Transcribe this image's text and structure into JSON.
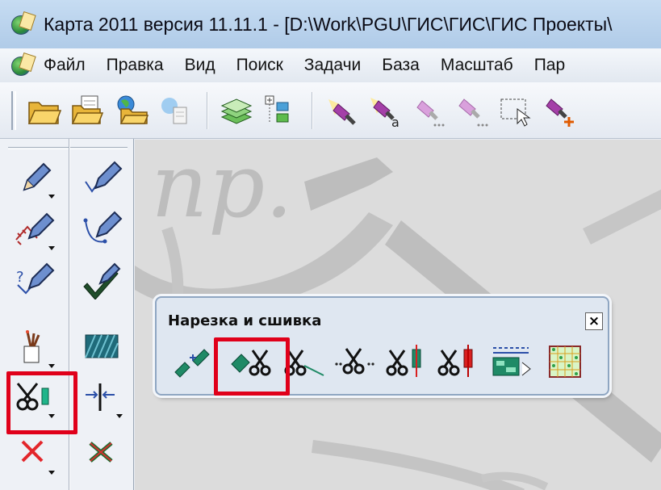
{
  "window": {
    "title": "Карта 2011 версия 11.11.1 - [D:\\Work\\PGU\\ГИС\\ГИС\\ГИС Проекты\\",
    "app_icon": "globe-map-icon"
  },
  "menu": {
    "items": [
      "Файл",
      "Правка",
      "Вид",
      "Поиск",
      "Задачи",
      "База",
      "Масштаб",
      "Пар"
    ]
  },
  "toolbar": {
    "buttons": [
      "open-folder-icon",
      "open-list-icon",
      "open-map-icon",
      "open-data-icon",
      "layers-icon",
      "tree-list-icon",
      "select-object-icon",
      "select-text-icon",
      "select-more-icon",
      "select-points-icon",
      "select-frame-icon",
      "select-add-icon"
    ],
    "select_text_letter": "a"
  },
  "left_panel": {
    "tools": [
      "create-object-icon",
      "create-line-icon",
      "edit-object-icon",
      "create-spline-icon",
      "copy-object-icon",
      "check-object-icon",
      "paint-style-icon",
      "fill-area-icon",
      "cut-stitch-icon",
      "split-line-icon",
      "delete-object-icon",
      "delete-points-icon"
    ]
  },
  "floating_toolbar": {
    "title": "Нарезка и сшивка",
    "close_label": "×",
    "tools": [
      "stitch-objects-icon",
      "cut-object-icon",
      "cut-by-line-icon",
      "cut-by-points-icon",
      "cut-area-icon",
      "cut-red-icon",
      "cut-layout-icon",
      "grid-cut-icon"
    ]
  },
  "highlight": {
    "color": "#e0001a",
    "targets": [
      "cut-stitch-tool",
      "cut-object-tool"
    ]
  },
  "canvas": {
    "map_text": "пр."
  }
}
